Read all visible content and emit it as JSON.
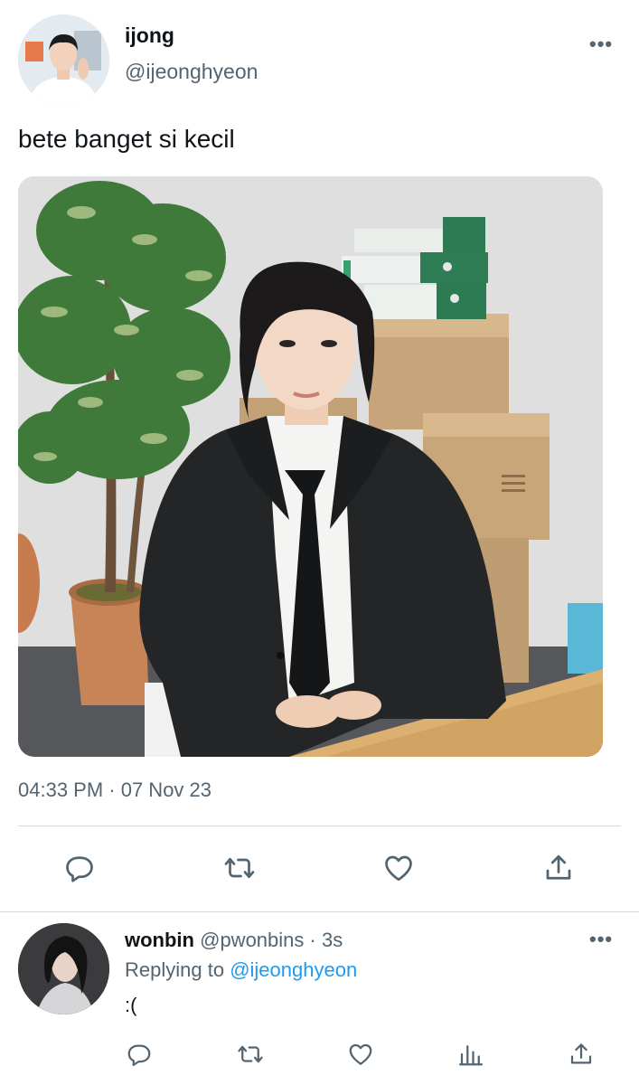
{
  "tweet": {
    "author_name": "ijong",
    "author_handle": "@ijeonghyeon",
    "text": "bete banget si kecil",
    "timestamp": "04:33 PM · 07 Nov 23",
    "more_label": "•••",
    "actions": [
      "reply-icon",
      "retweet-icon",
      "like-icon",
      "share-icon"
    ]
  },
  "reply": {
    "author_name": "wonbin",
    "author_handle": "@pwonbins",
    "separator": "·",
    "time": "3s",
    "replying_prefix": "Replying to",
    "replying_to": "@ijeonghyeon",
    "text": ":(",
    "more_label": "•••",
    "actions": [
      "reply-icon",
      "retweet-icon",
      "like-icon",
      "views-icon",
      "share-icon"
    ]
  },
  "colors": {
    "text_primary": "#0f1419",
    "text_secondary": "#536471",
    "accent": "#1d9bf0",
    "divider": "#cfd9de"
  }
}
